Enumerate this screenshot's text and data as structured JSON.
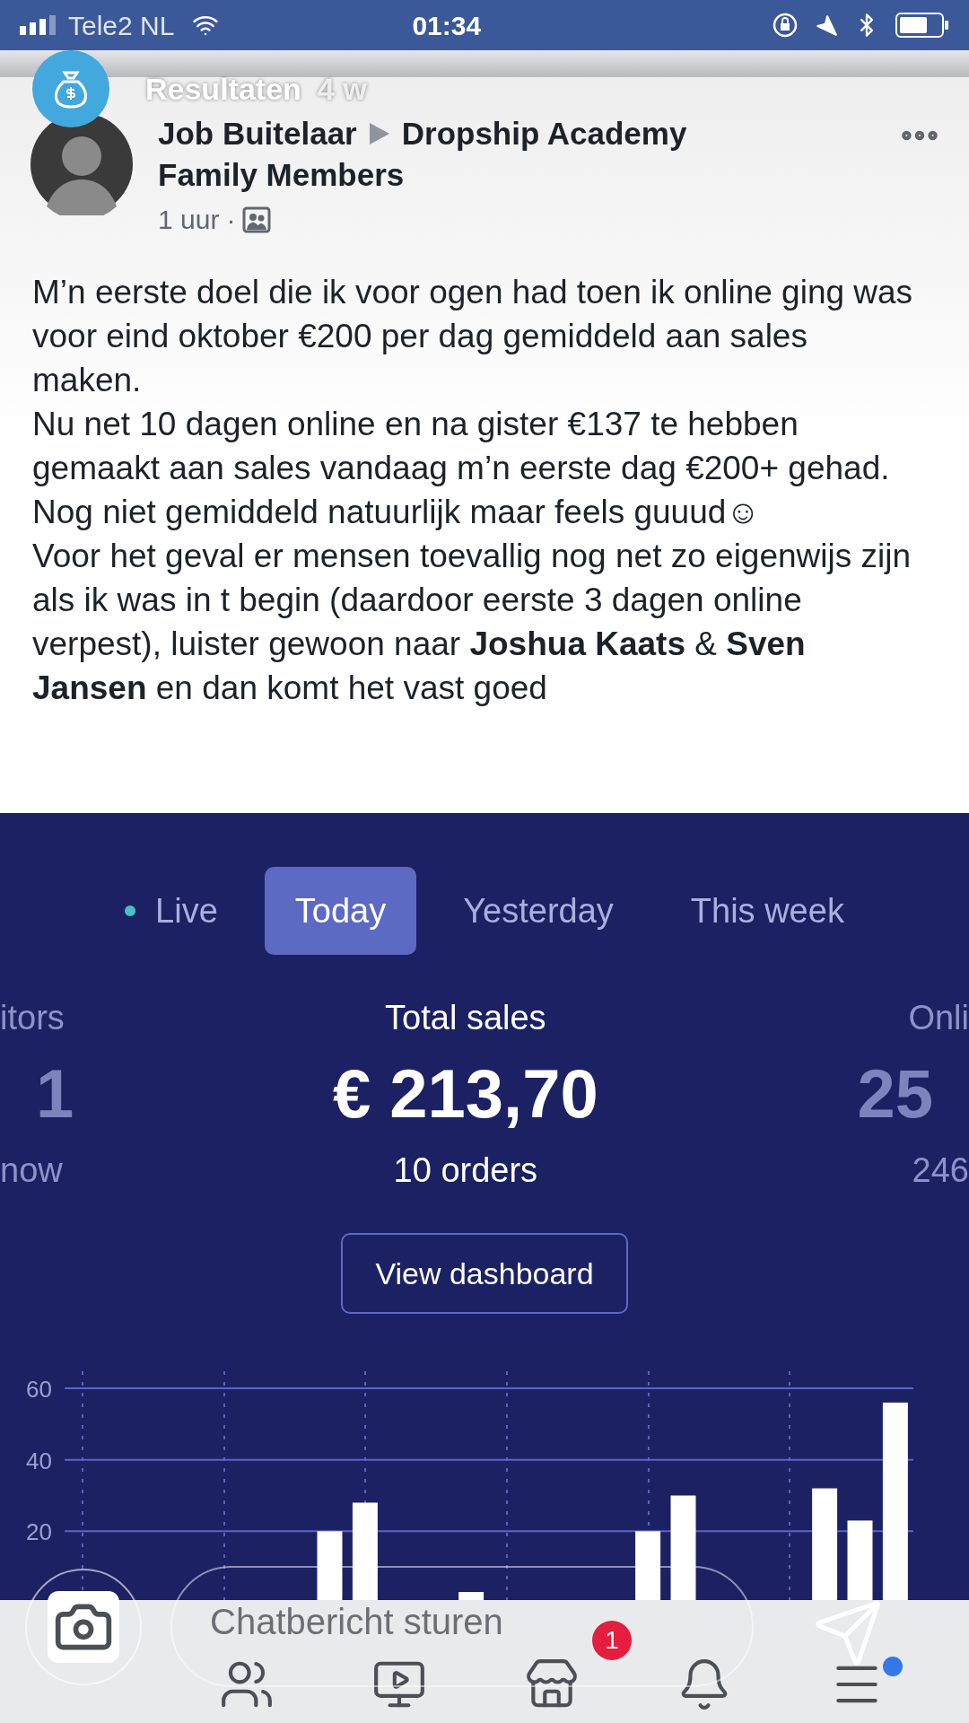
{
  "status_bar": {
    "carrier": "Tele2 NL",
    "time": "01:34"
  },
  "story": {
    "title": "Resultaten",
    "age": "4 w"
  },
  "post": {
    "author": "Job Buitelaar",
    "group_lines": [
      "Dropship Academy",
      "Family Members"
    ],
    "time": "1 uur",
    "separator": "·",
    "paragraphs": [
      "M’n eerste doel die ik voor ogen had toen ik online ging was voor eind oktober €200 per dag gemiddeld aan sales maken.",
      "Nu net 10 dagen online en na gister €137 te hebben gemaakt aan sales vandaag m’n eerste dag €200+ gehad. Nog niet gemiddeld natuurlijk maar feels guuud☺",
      "Voor het geval er mensen toevallig nog net zo eigenwijs zijn als ik was in t begin (daardoor eerste 3 dagen online verpest), luister gewoon naar **Joshua Kaats** & **Sven Jansen** en dan komt het vast goed"
    ]
  },
  "shop": {
    "tabs": [
      {
        "label": "Live",
        "selected": false,
        "live": true
      },
      {
        "label": "Today",
        "selected": true,
        "live": false
      },
      {
        "label": "Yesterday",
        "selected": false,
        "live": false
      },
      {
        "label": "This week",
        "selected": false,
        "live": false
      }
    ],
    "stats": [
      {
        "label": "itors",
        "value": "1",
        "note": "now",
        "highlighted": false
      },
      {
        "label": "Total sales",
        "value": "€ 213,70",
        "note": "10 orders",
        "highlighted": true
      },
      {
        "label": "Onli",
        "value": "25",
        "note": "246",
        "highlighted": false
      }
    ],
    "button": "View dashboard",
    "chart_data": {
      "type": "bar",
      "grid": true,
      "yticks": [
        20,
        40,
        60
      ],
      "ylim": [
        0,
        60
      ],
      "values": [
        null,
        null,
        null,
        null,
        null,
        null,
        null,
        20,
        28,
        null,
        null,
        3,
        null,
        null,
        null,
        null,
        20,
        30,
        null,
        null,
        null,
        32,
        23,
        56
      ]
    }
  },
  "story_reply": {
    "placeholder": "Chatbericht sturen"
  },
  "nav": [
    {
      "kind": "friends"
    },
    {
      "kind": "video"
    },
    {
      "kind": "marketplace",
      "badge": "1"
    },
    {
      "kind": "notifications"
    },
    {
      "kind": "menu",
      "dot": true
    }
  ]
}
